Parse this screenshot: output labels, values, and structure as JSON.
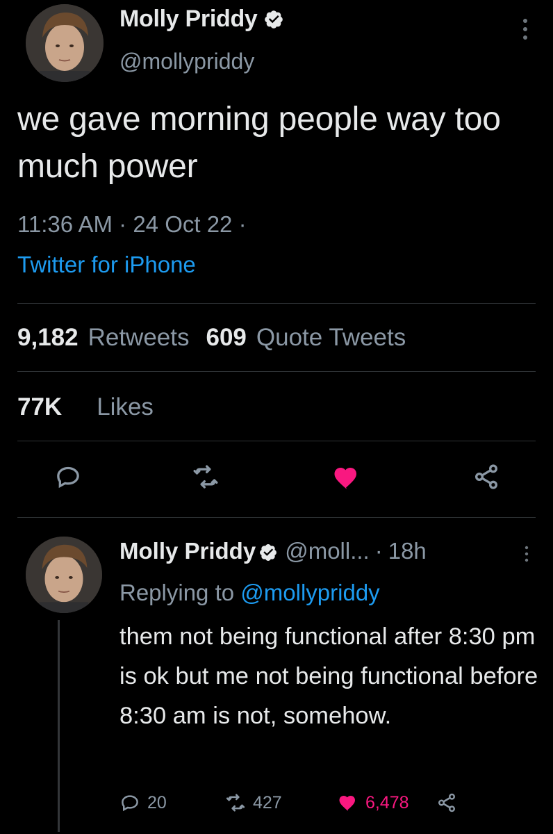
{
  "tweet": {
    "author_name": "Molly Priddy",
    "author_handle": "@mollypriddy",
    "text": "we gave morning people way too much power",
    "time": "11:36 AM",
    "date": "24 Oct 22",
    "source": "Twitter for iPhone",
    "retweets_count": "9,182",
    "retweets_label": "Retweets",
    "quotes_count": "609",
    "quotes_label": "Quote Tweets",
    "likes_count": "77K",
    "likes_label": "Likes",
    "liked": true
  },
  "reply": {
    "author_name": "Molly Priddy",
    "author_handle": "@moll...",
    "age": "18h",
    "replying_prefix": "Replying to",
    "replying_to": "@mollypriddy",
    "text": "them not being functional after 8:30 pm is ok but me not being functional before 8:30 am is not, somehow.",
    "reply_count": "20",
    "retweet_count": "427",
    "like_count": "6,478",
    "liked": true
  },
  "colors": {
    "background": "#000000",
    "primary_text": "#e7e9ea",
    "secondary_text": "#8b98a5",
    "link": "#1d9bf0",
    "like": "#f91880",
    "divider": "#2f3336"
  },
  "icons": [
    "verified-badge-icon",
    "more-icon",
    "reply-icon",
    "retweet-icon",
    "heart-icon",
    "share-icon"
  ]
}
